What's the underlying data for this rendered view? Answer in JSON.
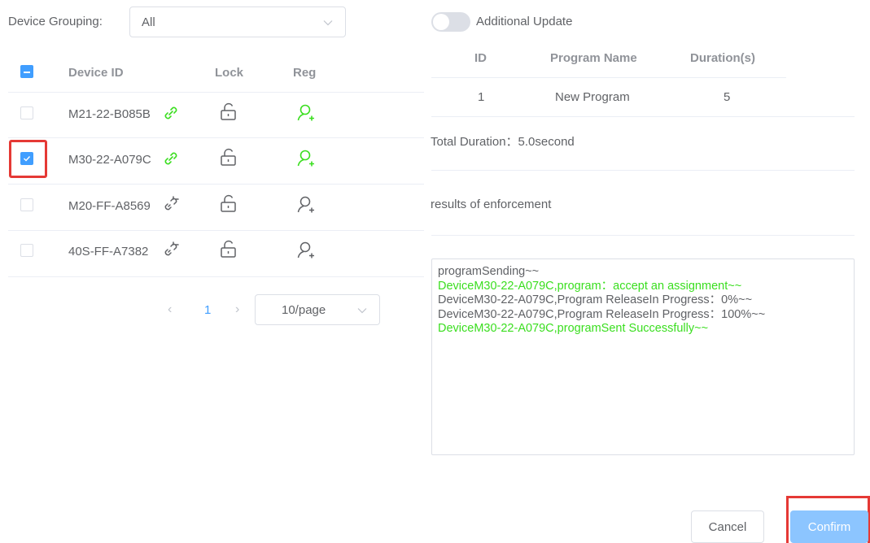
{
  "device_grouping": {
    "label": "Device Grouping:",
    "value": "All"
  },
  "device_table": {
    "headers": {
      "device_id": "Device ID",
      "lock": "Lock",
      "reg": "Reg"
    },
    "rows": [
      {
        "device_id": "M21-22-B085B",
        "link": "linked",
        "reg": "active",
        "checked": false
      },
      {
        "device_id": "M30-22-A079C",
        "link": "linked",
        "reg": "active",
        "checked": true
      },
      {
        "device_id": "M20-FF-A8569",
        "link": "broken",
        "reg": "inactive",
        "checked": false
      },
      {
        "device_id": "40S-FF-A7382",
        "link": "broken",
        "reg": "inactive",
        "checked": false
      }
    ]
  },
  "pagination": {
    "current_page": "1",
    "page_size": "10/page"
  },
  "additional_update": {
    "label": "Additional Update",
    "enabled": false
  },
  "program_table": {
    "headers": {
      "id": "ID",
      "name": "Program Name",
      "duration": "Duration(s)"
    },
    "rows": [
      {
        "id": "1",
        "name": "New Program",
        "duration": "5"
      }
    ]
  },
  "total_duration": "Total Duration：5.0second",
  "results_label": "results of enforcement",
  "log_lines": [
    {
      "text": "programSending~~",
      "status": "normal"
    },
    {
      "text": "DeviceM30-22-A079C,program：accept an assignment~~",
      "status": "success"
    },
    {
      "text": "DeviceM30-22-A079C,Program ReleaseIn Progress：0%~~",
      "status": "normal"
    },
    {
      "text": "DeviceM30-22-A079C,Program ReleaseIn Progress：100%~~",
      "status": "normal"
    },
    {
      "text": "DeviceM30-22-A079C,programSent Successfully~~",
      "status": "success"
    }
  ],
  "buttons": {
    "cancel": "Cancel",
    "confirm": "Confirm"
  },
  "colors": {
    "primary": "#409eff",
    "success_green": "#3ade1f",
    "highlight_red": "#e53935",
    "confirm_disabled": "#8cc5ff"
  }
}
